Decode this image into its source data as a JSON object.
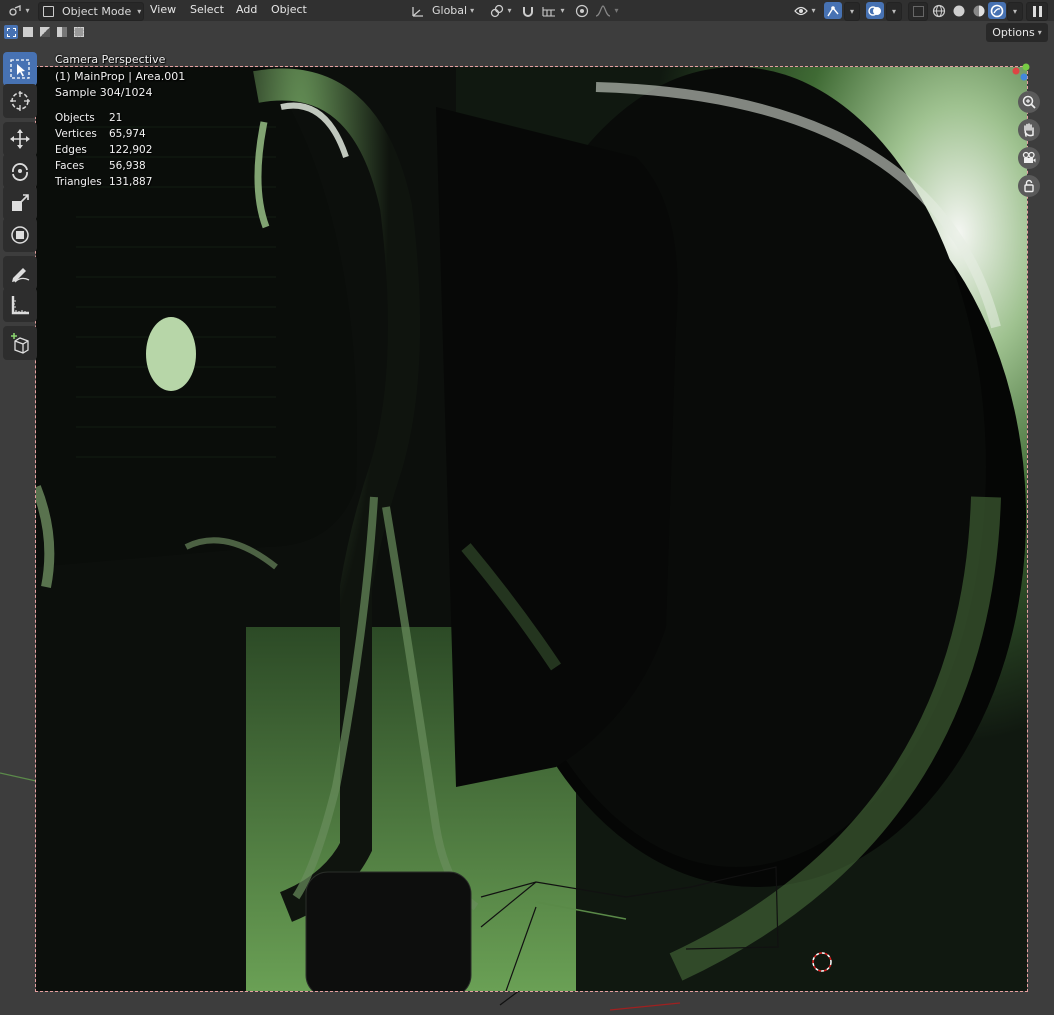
{
  "header": {
    "mode_label": "Object Mode",
    "menus": [
      "View",
      "Select",
      "Add",
      "Object"
    ],
    "transform_orientation": "Global"
  },
  "toolrow": {
    "options_label": "Options"
  },
  "overlay": {
    "view_name": "Camera Perspective",
    "object_info": "(1) MainProp | Area.001",
    "sample": "Sample 304/1024",
    "stats": [
      {
        "label": "Objects",
        "value": "21"
      },
      {
        "label": "Vertices",
        "value": "65,974"
      },
      {
        "label": "Edges",
        "value": "122,902"
      },
      {
        "label": "Faces",
        "value": "56,938"
      },
      {
        "label": "Triangles",
        "value": "131,887"
      }
    ]
  },
  "tools": [
    "select-box",
    "cursor",
    "move",
    "rotate",
    "scale",
    "transform",
    "annotate",
    "measure",
    "add-cube"
  ],
  "colors": {
    "accent": "#4772b3",
    "header_bg": "#303030",
    "viewport_bg": "#3d3d3d",
    "render_green": "#6fa85a",
    "camera_border": "#e5a0a0"
  }
}
